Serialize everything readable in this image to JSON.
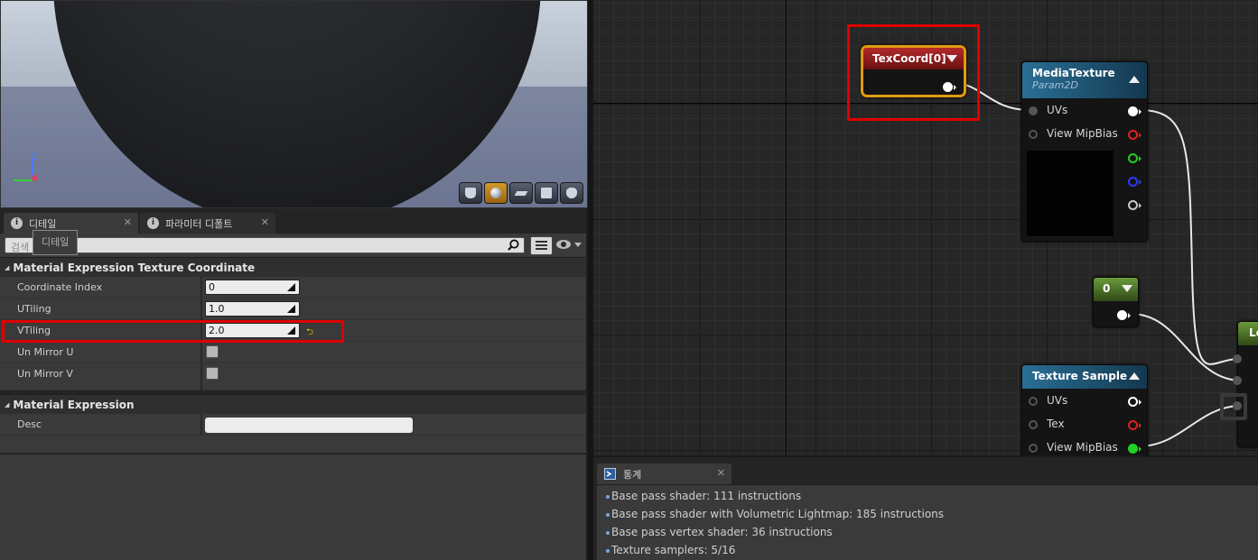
{
  "viewport": {
    "axis_z": "Z",
    "axis_x": "X",
    "buttons": [
      "cylinder",
      "sphere",
      "plane",
      "cube",
      "teapot"
    ]
  },
  "details": {
    "tabs": [
      {
        "label": "디테일",
        "active": true
      },
      {
        "label": "파라미터 디폴트",
        "active": false
      }
    ],
    "tooltip": "디테일",
    "search_placeholder": "검색 디테일",
    "categories": [
      {
        "title": "Material Expression Texture Coordinate",
        "properties": [
          {
            "name": "Coordinate Index",
            "value": "0",
            "type": "number"
          },
          {
            "name": "UTiling",
            "value": "1.0",
            "type": "number"
          },
          {
            "name": "VTiling",
            "value": "2.0",
            "type": "number",
            "modified": true
          },
          {
            "name": "Un Mirror U",
            "type": "checkbox",
            "checked": false
          },
          {
            "name": "Un Mirror V",
            "type": "checkbox",
            "checked": false
          }
        ]
      },
      {
        "title": "Material Expression",
        "properties": [
          {
            "name": "Desc",
            "value": "",
            "type": "text"
          }
        ]
      }
    ]
  },
  "graph": {
    "texcoord": {
      "title": "TexCoord[0]",
      "header_color": "#9a1a1a",
      "outline_color": "#e09a10"
    },
    "mediatexture": {
      "title": "MediaTexture",
      "subtitle": "Param2D",
      "header_color": "#1f5f80",
      "inputs": [
        "UVs",
        "View MipBias"
      ],
      "outputs": [
        "#ffffff",
        "#e02020",
        "#20d020",
        "#2020e0",
        "#c8c8c8"
      ]
    },
    "constant": {
      "title": "0",
      "header_color": "#4e7a2a"
    },
    "texture_sample": {
      "title": "Texture Sample",
      "header_color": "#1f5f80",
      "inputs": [
        "UVs",
        "Tex",
        "View MipBias"
      ]
    },
    "partial_node": {
      "title": "Le",
      "header_color": "#4e7a2a"
    }
  },
  "stats": {
    "tab_label": "통계",
    "lines": [
      "Base pass shader: 111 instructions",
      "Base pass shader with Volumetric Lightmap: 185 instructions",
      "Base pass vertex shader: 36 instructions",
      "Texture samplers: 5/16"
    ]
  }
}
